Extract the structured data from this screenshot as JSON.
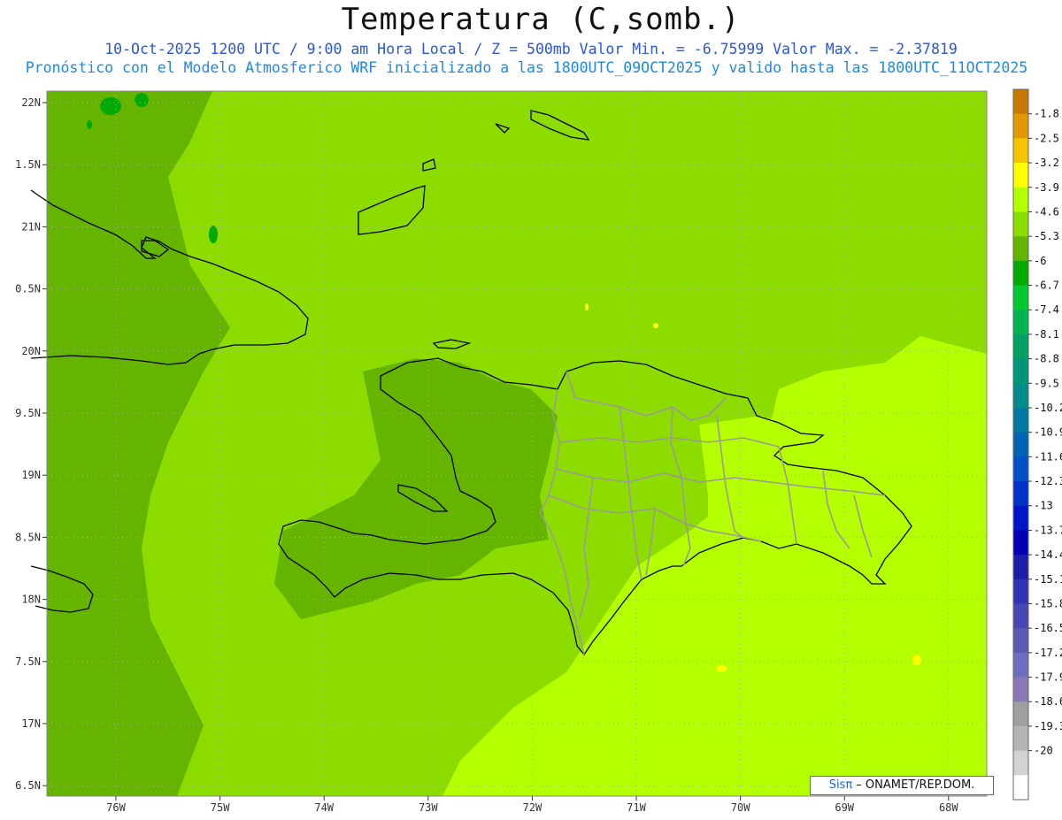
{
  "title": "Temperatura (C,somb.)",
  "subtitle_line1": "10-Oct-2025  1200 UTC / 9:00 am Hora Local / Z = 500mb  Valor Min. = -6.75999  Valor Max. = -2.37819",
  "subtitle_line2": "Pronóstico con el Modelo Atmosferico WRF inicializado a las 1800UTC_09OCT2025 y valido hasta las  1800UTC_11OCT2025",
  "lat_ticks": [
    "22N",
    "1.5N",
    "21N",
    "0.5N",
    "20N",
    "9.5N",
    "19N",
    "8.5N",
    "18N",
    "7.5N",
    "17N",
    "6.5N"
  ],
  "lon_ticks": [
    "76W",
    "75W",
    "74W",
    "73W",
    "72W",
    "71W",
    "70W",
    "69W",
    "68W"
  ],
  "colorbar": {
    "labels": [
      "-1.8",
      "-2.5",
      "-3.2",
      "-3.9",
      "-4.6",
      "-5.3",
      "-6",
      "-6.7",
      "-7.4",
      "-8.1",
      "-8.8",
      "-9.5",
      "-10.2",
      "-10.9",
      "-11.6",
      "-12.3",
      "-13",
      "-13.7",
      "-14.4",
      "-15.1",
      "-15.8",
      "-16.5",
      "-17.2",
      "-17.9",
      "-18.6",
      "-19.3",
      "-20"
    ],
    "colors": [
      "#c87800",
      "#e09a00",
      "#f5c400",
      "#ffff00",
      "#b4ff00",
      "#8cdc00",
      "#64b400",
      "#00aa00",
      "#00c832",
      "#00b450",
      "#00a064",
      "#009678",
      "#008c8c",
      "#0078a0",
      "#0064b4",
      "#0050c8",
      "#0032c8",
      "#0014c8",
      "#0000b4",
      "#1e1eaa",
      "#3232b4",
      "#4646b4",
      "#5a5ab4",
      "#6e6ebe",
      "#8c78b4",
      "#a0a0a0",
      "#b4b4b4",
      "#d2d2d2",
      "#ffffff"
    ]
  },
  "field_colors": {
    "dark": "#64b400",
    "mid": "#8cdc00",
    "light": "#b4ff00",
    "yellow": "#ffff00",
    "green": "#00aa00"
  },
  "credit": {
    "sis": "Sisπ",
    "org": " – ONAMET/REP.DOM."
  }
}
